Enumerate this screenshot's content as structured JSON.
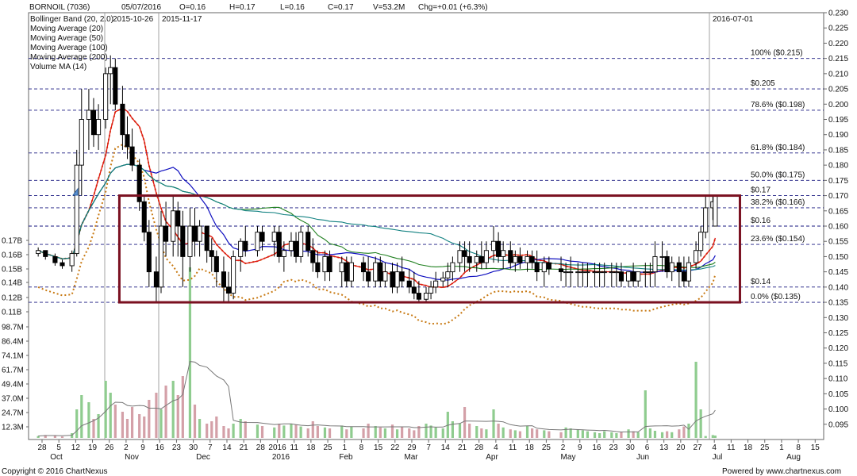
{
  "header": {
    "symbol": "BORNOIL (7036)",
    "date": "05/07/2016",
    "open": "O=0.16",
    "high": "H=0.17",
    "low": "L=0.16",
    "close": "C=0.17",
    "volume": "V=53.2M",
    "change": "Chg=+0.01 (+6.3%)"
  },
  "legend": [
    {
      "label": "Bollinger Band (20, 2.0)",
      "color": "#c87a14"
    },
    {
      "label": "Moving Average (20)",
      "color": "#e01010"
    },
    {
      "label": "Moving Average (50)",
      "color": "#1010c0"
    },
    {
      "label": "Moving Average (100)",
      "color": "#208020"
    },
    {
      "label": "Moving Average (200)",
      "color": "#108080"
    },
    {
      "label": "Volume MA (14)",
      "color": "#777777"
    }
  ],
  "marker_dates": [
    "2015-10-26",
    "2015-11-17",
    "2016-07-01"
  ],
  "footer": {
    "copyright": "Copyright © 2016 ChartNexus",
    "powered": "Powered by www.chartnexus.com"
  },
  "chart_data": {
    "type": "candlestick",
    "price_axis": {
      "side": "right",
      "ylim": [
        0.09,
        0.23
      ],
      "ticks": [
        "0.230",
        "0.225",
        "0.220",
        "0.215",
        "0.210",
        "0.205",
        "0.200",
        "0.195",
        "0.190",
        "0.185",
        "0.180",
        "0.175",
        "0.170",
        "0.165",
        "0.160",
        "0.155",
        "0.150",
        "0.145",
        "0.140",
        "0.135",
        "0.130",
        "0.125",
        "0.120",
        "0.115",
        "0.110",
        "0.105",
        "0.100",
        "0.095"
      ]
    },
    "volume_axis": {
      "side": "left",
      "ticks": [
        "0.17B",
        "0.16B",
        "0.15B",
        "0.14B",
        "0.12B",
        "0.11B",
        "98.7M",
        "86.4M",
        "74.1M",
        "61.7M",
        "49.4M",
        "37.0M",
        "24.7M",
        "12.3M"
      ]
    },
    "x_axis": {
      "ticks": [
        "28",
        "5",
        "12",
        "19",
        "26",
        "2",
        "9",
        "16",
        "23",
        "30",
        "7",
        "14",
        "21",
        "28",
        "2016",
        "11",
        "18",
        "25",
        "1",
        "8",
        "15",
        "22",
        "29",
        "7",
        "14",
        "21",
        "28",
        "4",
        "11",
        "18",
        "25",
        "2",
        "9",
        "16",
        "23",
        "30",
        "6",
        "13",
        "20",
        "27",
        "4",
        "11",
        "18",
        "25",
        "1",
        "8",
        "15"
      ],
      "month_labels": [
        "Oct",
        "Nov",
        "Dec",
        "2016",
        "Feb",
        "Mar",
        "Apr",
        "May",
        "Jun",
        "Jul",
        "Aug"
      ]
    },
    "fibonacci": [
      {
        "label": "100%  ($0.215)",
        "value": 0.215
      },
      {
        "label": "78.6%  ($0.198)",
        "value": 0.198
      },
      {
        "label": "61.8%  ($0.184)",
        "value": 0.184
      },
      {
        "label": "50.0%  ($0.175)",
        "value": 0.175
      },
      {
        "label": "38.2%  ($0.166)",
        "value": 0.166
      },
      {
        "label": "23.6%  ($0.154)",
        "value": 0.154
      },
      {
        "label": "0.0%  ($0.135)",
        "value": 0.135
      }
    ],
    "levels": [
      {
        "label": "$0.205",
        "value": 0.205
      },
      {
        "label": "$0.17",
        "value": 0.17
      },
      {
        "label": "$0.16",
        "value": 0.16
      },
      {
        "label": "$0.14",
        "value": 0.14
      }
    ],
    "range_box": {
      "from": "2015-11-02",
      "to": "2016-07-08",
      "high": 0.17,
      "low": 0.135
    },
    "candles": [
      {
        "date": "2015-09-28",
        "o": 0.151,
        "h": 0.153,
        "l": 0.15,
        "c": 0.152
      },
      {
        "date": "2015-10-01",
        "o": 0.152,
        "h": 0.152,
        "l": 0.149,
        "c": 0.15
      },
      {
        "date": "2015-10-05",
        "o": 0.15,
        "h": 0.151,
        "l": 0.147,
        "c": 0.148
      },
      {
        "date": "2015-10-08",
        "o": 0.148,
        "h": 0.149,
        "l": 0.146,
        "c": 0.147
      },
      {
        "date": "2015-10-12",
        "o": 0.147,
        "h": 0.152,
        "l": 0.145,
        "c": 0.151
      },
      {
        "date": "2015-10-14",
        "o": 0.151,
        "h": 0.185,
        "l": 0.15,
        "c": 0.18
      },
      {
        "date": "2015-10-16",
        "o": 0.18,
        "h": 0.205,
        "l": 0.17,
        "c": 0.195
      },
      {
        "date": "2015-10-19",
        "o": 0.195,
        "h": 0.205,
        "l": 0.185,
        "c": 0.198
      },
      {
        "date": "2015-10-21",
        "o": 0.198,
        "h": 0.202,
        "l": 0.186,
        "c": 0.19
      },
      {
        "date": "2015-10-23",
        "o": 0.19,
        "h": 0.2,
        "l": 0.185,
        "c": 0.195
      },
      {
        "date": "2015-10-26",
        "o": 0.195,
        "h": 0.212,
        "l": 0.192,
        "c": 0.21
      },
      {
        "date": "2015-10-28",
        "o": 0.21,
        "h": 0.216,
        "l": 0.2,
        "c": 0.212
      },
      {
        "date": "2015-10-30",
        "o": 0.212,
        "h": 0.215,
        "l": 0.198,
        "c": 0.2
      },
      {
        "date": "2015-11-02",
        "o": 0.2,
        "h": 0.206,
        "l": 0.185,
        "c": 0.19
      },
      {
        "date": "2015-11-04",
        "o": 0.19,
        "h": 0.196,
        "l": 0.182,
        "c": 0.186
      },
      {
        "date": "2015-11-06",
        "o": 0.186,
        "h": 0.192,
        "l": 0.178,
        "c": 0.18
      },
      {
        "date": "2015-11-09",
        "o": 0.18,
        "h": 0.182,
        "l": 0.165,
        "c": 0.168
      },
      {
        "date": "2015-11-11",
        "o": 0.168,
        "h": 0.17,
        "l": 0.155,
        "c": 0.158
      },
      {
        "date": "2015-11-13",
        "o": 0.158,
        "h": 0.162,
        "l": 0.14,
        "c": 0.145
      },
      {
        "date": "2015-11-16",
        "o": 0.145,
        "h": 0.15,
        "l": 0.135,
        "c": 0.14
      },
      {
        "date": "2015-11-18",
        "o": 0.14,
        "h": 0.165,
        "l": 0.138,
        "c": 0.16
      },
      {
        "date": "2015-11-20",
        "o": 0.16,
        "h": 0.168,
        "l": 0.15,
        "c": 0.155
      },
      {
        "date": "2015-11-23",
        "o": 0.155,
        "h": 0.17,
        "l": 0.15,
        "c": 0.165
      },
      {
        "date": "2015-11-25",
        "o": 0.165,
        "h": 0.168,
        "l": 0.15,
        "c": 0.16
      },
      {
        "date": "2015-11-27",
        "o": 0.16,
        "h": 0.165,
        "l": 0.14,
        "c": 0.15
      },
      {
        "date": "2015-11-30",
        "o": 0.15,
        "h": 0.166,
        "l": 0.145,
        "c": 0.16
      },
      {
        "date": "2015-12-02",
        "o": 0.16,
        "h": 0.166,
        "l": 0.15,
        "c": 0.155
      },
      {
        "date": "2015-12-04",
        "o": 0.155,
        "h": 0.162,
        "l": 0.15,
        "c": 0.16
      },
      {
        "date": "2015-12-07",
        "o": 0.16,
        "h": 0.16,
        "l": 0.148,
        "c": 0.152
      },
      {
        "date": "2015-12-09",
        "o": 0.152,
        "h": 0.156,
        "l": 0.145,
        "c": 0.15
      },
      {
        "date": "2015-12-11",
        "o": 0.15,
        "h": 0.152,
        "l": 0.14,
        "c": 0.145
      },
      {
        "date": "2015-12-14",
        "o": 0.145,
        "h": 0.15,
        "l": 0.135,
        "c": 0.14
      },
      {
        "date": "2015-12-16",
        "o": 0.14,
        "h": 0.145,
        "l": 0.135,
        "c": 0.138
      },
      {
        "date": "2015-12-18",
        "o": 0.138,
        "h": 0.152,
        "l": 0.136,
        "c": 0.15
      },
      {
        "date": "2015-12-21",
        "o": 0.15,
        "h": 0.156,
        "l": 0.145,
        "c": 0.155
      },
      {
        "date": "2015-12-23",
        "o": 0.155,
        "h": 0.16,
        "l": 0.15,
        "c": 0.152
      },
      {
        "date": "2015-12-28",
        "o": 0.152,
        "h": 0.16,
        "l": 0.15,
        "c": 0.158
      },
      {
        "date": "2015-12-30",
        "o": 0.158,
        "h": 0.16,
        "l": 0.152,
        "c": 0.155
      },
      {
        "date": "2016-01-04",
        "o": 0.155,
        "h": 0.16,
        "l": 0.15,
        "c": 0.158
      },
      {
        "date": "2016-01-06",
        "o": 0.158,
        "h": 0.16,
        "l": 0.148,
        "c": 0.15
      },
      {
        "date": "2016-01-08",
        "o": 0.15,
        "h": 0.155,
        "l": 0.145,
        "c": 0.152
      },
      {
        "date": "2016-01-11",
        "o": 0.152,
        "h": 0.158,
        "l": 0.15,
        "c": 0.155
      },
      {
        "date": "2016-01-13",
        "o": 0.155,
        "h": 0.158,
        "l": 0.148,
        "c": 0.15
      },
      {
        "date": "2016-01-15",
        "o": 0.15,
        "h": 0.16,
        "l": 0.148,
        "c": 0.158
      },
      {
        "date": "2016-01-18",
        "o": 0.158,
        "h": 0.16,
        "l": 0.15,
        "c": 0.152
      },
      {
        "date": "2016-01-20",
        "o": 0.152,
        "h": 0.156,
        "l": 0.145,
        "c": 0.148
      },
      {
        "date": "2016-01-22",
        "o": 0.148,
        "h": 0.152,
        "l": 0.143,
        "c": 0.145
      },
      {
        "date": "2016-01-25",
        "o": 0.145,
        "h": 0.152,
        "l": 0.142,
        "c": 0.15
      },
      {
        "date": "2016-01-27",
        "o": 0.15,
        "h": 0.152,
        "l": 0.142,
        "c": 0.145
      },
      {
        "date": "2016-02-01",
        "o": 0.145,
        "h": 0.15,
        "l": 0.14,
        "c": 0.148
      },
      {
        "date": "2016-02-03",
        "o": 0.148,
        "h": 0.15,
        "l": 0.14,
        "c": 0.142
      },
      {
        "date": "2016-02-05",
        "o": 0.142,
        "h": 0.15,
        "l": 0.14,
        "c": 0.148
      },
      {
        "date": "2016-02-10",
        "o": 0.148,
        "h": 0.15,
        "l": 0.142,
        "c": 0.145
      },
      {
        "date": "2016-02-12",
        "o": 0.145,
        "h": 0.15,
        "l": 0.14,
        "c": 0.142
      },
      {
        "date": "2016-02-15",
        "o": 0.142,
        "h": 0.15,
        "l": 0.14,
        "c": 0.148
      },
      {
        "date": "2016-02-17",
        "o": 0.148,
        "h": 0.15,
        "l": 0.14,
        "c": 0.142
      },
      {
        "date": "2016-02-19",
        "o": 0.142,
        "h": 0.148,
        "l": 0.14,
        "c": 0.145
      },
      {
        "date": "2016-02-22",
        "o": 0.145,
        "h": 0.148,
        "l": 0.138,
        "c": 0.14
      },
      {
        "date": "2016-02-24",
        "o": 0.14,
        "h": 0.148,
        "l": 0.138,
        "c": 0.145
      },
      {
        "date": "2016-02-26",
        "o": 0.145,
        "h": 0.15,
        "l": 0.14,
        "c": 0.142
      },
      {
        "date": "2016-02-29",
        "o": 0.142,
        "h": 0.146,
        "l": 0.138,
        "c": 0.14
      },
      {
        "date": "2016-03-02",
        "o": 0.14,
        "h": 0.145,
        "l": 0.136,
        "c": 0.138
      },
      {
        "date": "2016-03-04",
        "o": 0.138,
        "h": 0.142,
        "l": 0.135,
        "c": 0.136
      },
      {
        "date": "2016-03-07",
        "o": 0.136,
        "h": 0.14,
        "l": 0.135,
        "c": 0.138
      },
      {
        "date": "2016-03-09",
        "o": 0.138,
        "h": 0.142,
        "l": 0.136,
        "c": 0.14
      },
      {
        "date": "2016-03-11",
        "o": 0.14,
        "h": 0.145,
        "l": 0.138,
        "c": 0.142
      },
      {
        "date": "2016-03-14",
        "o": 0.142,
        "h": 0.145,
        "l": 0.14,
        "c": 0.143
      },
      {
        "date": "2016-03-16",
        "o": 0.143,
        "h": 0.148,
        "l": 0.14,
        "c": 0.145
      },
      {
        "date": "2016-03-18",
        "o": 0.145,
        "h": 0.15,
        "l": 0.142,
        "c": 0.148
      },
      {
        "date": "2016-03-21",
        "o": 0.148,
        "h": 0.155,
        "l": 0.145,
        "c": 0.152
      },
      {
        "date": "2016-03-23",
        "o": 0.152,
        "h": 0.155,
        "l": 0.145,
        "c": 0.15
      },
      {
        "date": "2016-03-25",
        "o": 0.15,
        "h": 0.155,
        "l": 0.145,
        "c": 0.148
      },
      {
        "date": "2016-03-28",
        "o": 0.148,
        "h": 0.152,
        "l": 0.145,
        "c": 0.15
      },
      {
        "date": "2016-03-30",
        "o": 0.15,
        "h": 0.155,
        "l": 0.146,
        "c": 0.148
      },
      {
        "date": "2016-04-01",
        "o": 0.148,
        "h": 0.155,
        "l": 0.146,
        "c": 0.152
      },
      {
        "date": "2016-04-04",
        "o": 0.152,
        "h": 0.16,
        "l": 0.148,
        "c": 0.155
      },
      {
        "date": "2016-04-06",
        "o": 0.155,
        "h": 0.158,
        "l": 0.148,
        "c": 0.15
      },
      {
        "date": "2016-04-08",
        "o": 0.15,
        "h": 0.155,
        "l": 0.146,
        "c": 0.152
      },
      {
        "date": "2016-04-11",
        "o": 0.152,
        "h": 0.155,
        "l": 0.146,
        "c": 0.148
      },
      {
        "date": "2016-04-13",
        "o": 0.148,
        "h": 0.152,
        "l": 0.145,
        "c": 0.15
      },
      {
        "date": "2016-04-15",
        "o": 0.15,
        "h": 0.153,
        "l": 0.146,
        "c": 0.148
      },
      {
        "date": "2016-04-18",
        "o": 0.148,
        "h": 0.152,
        "l": 0.145,
        "c": 0.15
      },
      {
        "date": "2016-04-20",
        "o": 0.15,
        "h": 0.152,
        "l": 0.146,
        "c": 0.148
      },
      {
        "date": "2016-04-22",
        "o": 0.148,
        "h": 0.152,
        "l": 0.142,
        "c": 0.145
      },
      {
        "date": "2016-04-25",
        "o": 0.145,
        "h": 0.15,
        "l": 0.14,
        "c": 0.148
      },
      {
        "date": "2016-04-27",
        "o": 0.148,
        "h": 0.15,
        "l": 0.144,
        "c": 0.146
      },
      {
        "date": "2016-05-02",
        "o": 0.146,
        "h": 0.15,
        "l": 0.142,
        "c": 0.145
      },
      {
        "date": "2016-05-04",
        "o": 0.145,
        "h": 0.148,
        "l": 0.14,
        "c": 0.145
      },
      {
        "date": "2016-05-06",
        "o": 0.145,
        "h": 0.15,
        "l": 0.14,
        "c": 0.145
      },
      {
        "date": "2016-05-09",
        "o": 0.145,
        "h": 0.148,
        "l": 0.14,
        "c": 0.145
      },
      {
        "date": "2016-05-11",
        "o": 0.145,
        "h": 0.148,
        "l": 0.14,
        "c": 0.145
      },
      {
        "date": "2016-05-13",
        "o": 0.145,
        "h": 0.148,
        "l": 0.14,
        "c": 0.145
      },
      {
        "date": "2016-05-16",
        "o": 0.145,
        "h": 0.148,
        "l": 0.14,
        "c": 0.145
      },
      {
        "date": "2016-05-18",
        "o": 0.145,
        "h": 0.148,
        "l": 0.14,
        "c": 0.145
      },
      {
        "date": "2016-05-20",
        "o": 0.145,
        "h": 0.148,
        "l": 0.14,
        "c": 0.145
      },
      {
        "date": "2016-05-23",
        "o": 0.145,
        "h": 0.148,
        "l": 0.14,
        "c": 0.145
      },
      {
        "date": "2016-05-25",
        "o": 0.145,
        "h": 0.148,
        "l": 0.14,
        "c": 0.145
      },
      {
        "date": "2016-05-27",
        "o": 0.145,
        "h": 0.148,
        "l": 0.14,
        "c": 0.142
      },
      {
        "date": "2016-05-30",
        "o": 0.142,
        "h": 0.145,
        "l": 0.14,
        "c": 0.145
      },
      {
        "date": "2016-06-01",
        "o": 0.145,
        "h": 0.148,
        "l": 0.14,
        "c": 0.142
      },
      {
        "date": "2016-06-03",
        "o": 0.142,
        "h": 0.145,
        "l": 0.14,
        "c": 0.145
      },
      {
        "date": "2016-06-06",
        "o": 0.145,
        "h": 0.148,
        "l": 0.14,
        "c": 0.145
      },
      {
        "date": "2016-06-08",
        "o": 0.145,
        "h": 0.148,
        "l": 0.14,
        "c": 0.145
      },
      {
        "date": "2016-06-10",
        "o": 0.145,
        "h": 0.155,
        "l": 0.14,
        "c": 0.15
      },
      {
        "date": "2016-06-13",
        "o": 0.15,
        "h": 0.155,
        "l": 0.145,
        "c": 0.15
      },
      {
        "date": "2016-06-15",
        "o": 0.15,
        "h": 0.152,
        "l": 0.143,
        "c": 0.145
      },
      {
        "date": "2016-06-17",
        "o": 0.145,
        "h": 0.15,
        "l": 0.142,
        "c": 0.148
      },
      {
        "date": "2016-06-20",
        "o": 0.148,
        "h": 0.15,
        "l": 0.14,
        "c": 0.145
      },
      {
        "date": "2016-06-22",
        "o": 0.145,
        "h": 0.15,
        "l": 0.14,
        "c": 0.142
      },
      {
        "date": "2016-06-24",
        "o": 0.142,
        "h": 0.15,
        "l": 0.14,
        "c": 0.148
      },
      {
        "date": "2016-06-27",
        "o": 0.148,
        "h": 0.155,
        "l": 0.146,
        "c": 0.152
      },
      {
        "date": "2016-06-29",
        "o": 0.152,
        "h": 0.16,
        "l": 0.15,
        "c": 0.158
      },
      {
        "date": "2016-07-01",
        "o": 0.158,
        "h": 0.17,
        "l": 0.156,
        "c": 0.166
      },
      {
        "date": "2016-07-04",
        "o": 0.166,
        "h": 0.17,
        "l": 0.162,
        "c": 0.168
      },
      {
        "date": "2016-07-05",
        "o": 0.16,
        "h": 0.17,
        "l": 0.16,
        "c": 0.17
      }
    ]
  }
}
